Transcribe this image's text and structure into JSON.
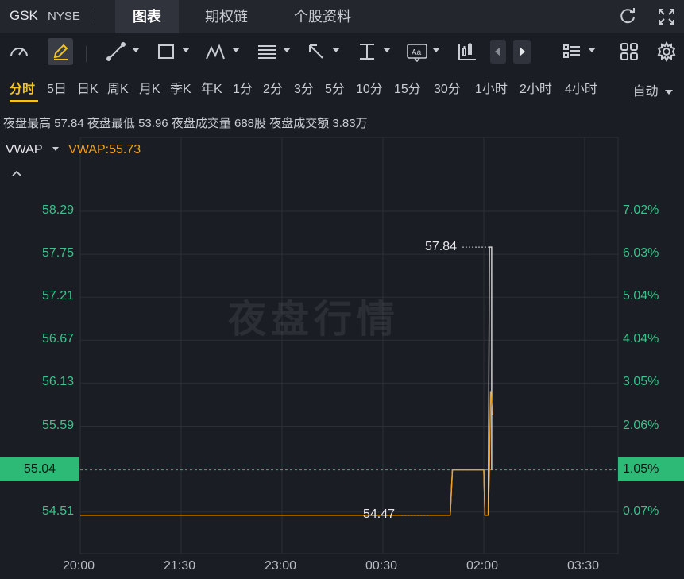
{
  "header": {
    "ticker": "GSK",
    "exchange": "NYSE",
    "tabs": [
      {
        "label": "图表",
        "active": true
      },
      {
        "label": "期权链",
        "active": false
      },
      {
        "label": "个股资料",
        "active": false
      }
    ],
    "icons": [
      "refresh-icon",
      "fullscreen-icon"
    ]
  },
  "toolbar": {
    "icons": [
      "gauge-icon",
      "pencil-icon",
      "line-tool-icon",
      "rectangle-tool-icon",
      "pattern-tool-icon",
      "fib-tool-icon",
      "arrow-tool-icon",
      "measure-tool-icon",
      "text-tool-icon",
      "candles-icon",
      "prev-arrow-icon",
      "next-arrow-icon",
      "list-layout-icon",
      "grid-layout-icon",
      "settings-gear-icon"
    ]
  },
  "periods": {
    "items": [
      "分时",
      "5日",
      "日K",
      "周K",
      "月K",
      "季K",
      "年K",
      "1分",
      "2分",
      "3分",
      "5分",
      "10分",
      "15分",
      "30分",
      "1小时",
      "2小时",
      "4小时"
    ],
    "active": "分时",
    "mode": "自动"
  },
  "stats": {
    "high_label": "夜盘最高",
    "high_value": "57.84",
    "low_label": "夜盘最低",
    "low_value": "53.96",
    "volume_label": "夜盘成交量",
    "volume_value": "688股",
    "turnover_label": "夜盘成交额",
    "turnover_value": "3.83万"
  },
  "indicator": {
    "name": "VWAP",
    "value_label": "VWAP:55.73"
  },
  "watermark": "夜盘行情",
  "colors": {
    "price_line": "#d9d9d9",
    "vwap_line": "#f0a020",
    "axis_text": "#3ac28a",
    "current_box": "#2dba77",
    "active_period": "#f5c319"
  },
  "chart_data": {
    "type": "line",
    "y_ticks_left": [
      "58.29",
      "57.75",
      "57.21",
      "56.67",
      "56.13",
      "55.59",
      "55.04",
      "54.51"
    ],
    "y_ticks_right": [
      "7.02%",
      "6.03%",
      "5.04%",
      "4.04%",
      "3.05%",
      "2.06%",
      "1.05%",
      "0.07%"
    ],
    "x_ticks": [
      "20:00",
      "21:30",
      "23:00",
      "00:30",
      "02:00",
      "03:30"
    ],
    "current_price": "55.04",
    "current_pct": "1.05%",
    "max_annotation": "57.84",
    "min_annotation": "54.47",
    "price_series": [
      {
        "x": "20:00",
        "y": 54.47
      },
      {
        "x": "01:30",
        "y": 54.47
      },
      {
        "x": "01:32",
        "y": 55.04
      },
      {
        "x": "02:00",
        "y": 55.04
      },
      {
        "x": "02:01",
        "y": 54.47
      },
      {
        "x": "02:04",
        "y": 54.47
      },
      {
        "x": "02:05",
        "y": 57.84
      },
      {
        "x": "02:07",
        "y": 57.84
      },
      {
        "x": "02:07",
        "y": 55.04
      }
    ],
    "vwap_series": [
      {
        "x": "20:00",
        "y": 54.47
      },
      {
        "x": "01:30",
        "y": 54.47
      },
      {
        "x": "01:32",
        "y": 55.04
      },
      {
        "x": "02:00",
        "y": 55.04
      },
      {
        "x": "02:01",
        "y": 54.47
      },
      {
        "x": "02:04",
        "y": 54.47
      },
      {
        "x": "02:05",
        "y": 55.04
      },
      {
        "x": "02:06",
        "y": 56.03
      },
      {
        "x": "02:08",
        "y": 55.73
      }
    ],
    "ylim": [
      54.3,
      58.6
    ]
  }
}
